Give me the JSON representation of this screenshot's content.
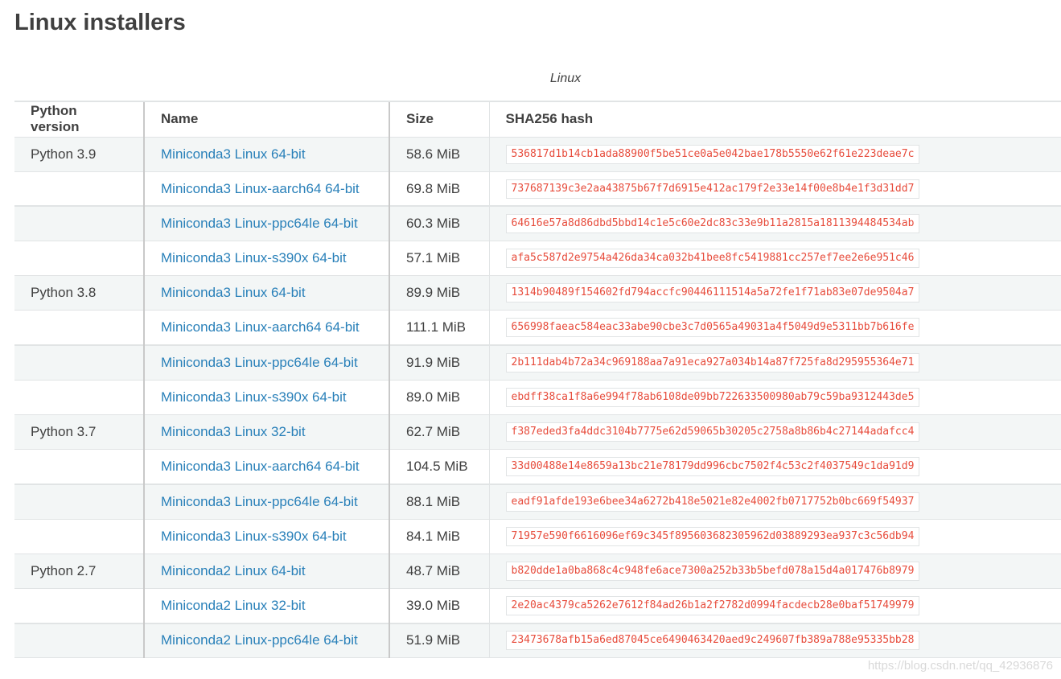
{
  "page": {
    "title": "Linux installers",
    "caption": "Linux",
    "watermark": "https://blog.csdn.net/qq_42936876"
  },
  "table": {
    "headers": [
      "Python version",
      "Name",
      "Size",
      "SHA256 hash"
    ],
    "rows": [
      {
        "version": "Python 3.9",
        "name": "Miniconda3 Linux 64-bit",
        "size": "58.6 MiB",
        "hash": "536817d1b14cb1ada88900f5be51ce0a5e042bae178b5550e62f61e223deae7c"
      },
      {
        "version": "",
        "name": "Miniconda3 Linux-aarch64 64-bit",
        "size": "69.8 MiB",
        "hash": "737687139c3e2aa43875b67f7d6915e412ac179f2e33e14f00e8b4e1f3d31dd7"
      },
      {
        "version": "",
        "name": "Miniconda3 Linux-ppc64le 64-bit",
        "size": "60.3 MiB",
        "hash": "64616e57a8d86dbd5bbd14c1e5c60e2dc83c33e9b11a2815a1811394484534ab"
      },
      {
        "version": "",
        "name": "Miniconda3 Linux-s390x 64-bit",
        "size": "57.1 MiB",
        "hash": "afa5c587d2e9754a426da34ca032b41bee8fc5419881cc257ef7ee2e6e951c46"
      },
      {
        "version": "Python 3.8",
        "name": "Miniconda3 Linux 64-bit",
        "size": "89.9 MiB",
        "hash": "1314b90489f154602fd794accfc90446111514a5a72fe1f71ab83e07de9504a7"
      },
      {
        "version": "",
        "name": "Miniconda3 Linux-aarch64 64-bit",
        "size": "111.1 MiB",
        "hash": "656998faeac584eac33abe90cbe3c7d0565a49031a4f5049d9e5311bb7b616fe"
      },
      {
        "version": "",
        "name": "Miniconda3 Linux-ppc64le 64-bit",
        "size": "91.9 MiB",
        "hash": "2b111dab4b72a34c969188aa7a91eca927a034b14a87f725fa8d295955364e71"
      },
      {
        "version": "",
        "name": "Miniconda3 Linux-s390x 64-bit",
        "size": "89.0 MiB",
        "hash": "ebdff38ca1f8a6e994f78ab6108de09bb722633500980ab79c59ba9312443de5"
      },
      {
        "version": "Python 3.7",
        "name": "Miniconda3 Linux 32-bit",
        "size": "62.7 MiB",
        "hash": "f387eded3fa4ddc3104b7775e62d59065b30205c2758a8b86b4c27144adafcc4"
      },
      {
        "version": "",
        "name": "Miniconda3 Linux-aarch64 64-bit",
        "size": "104.5 MiB",
        "hash": "33d00488e14e8659a13bc21e78179dd996cbc7502f4c53c2f4037549c1da91d9"
      },
      {
        "version": "",
        "name": "Miniconda3 Linux-ppc64le 64-bit",
        "size": "88.1 MiB",
        "hash": "eadf91afde193e6bee34a6272b418e5021e82e4002fb0717752b0bc669f54937"
      },
      {
        "version": "",
        "name": "Miniconda3 Linux-s390x 64-bit",
        "size": "84.1 MiB",
        "hash": "71957e590f6616096ef69c345f895603682305962d03889293ea937c3c56db94"
      },
      {
        "version": "Python 2.7",
        "name": "Miniconda2 Linux 64-bit",
        "size": "48.7 MiB",
        "hash": "b820dde1a0ba868c4c948fe6ace7300a252b33b5befd078a15d4a017476b8979"
      },
      {
        "version": "",
        "name": "Miniconda2 Linux 32-bit",
        "size": "39.0 MiB",
        "hash": "2e20ac4379ca5262e7612f84ad26b1a2f2782d0994facdecb28e0baf51749979"
      },
      {
        "version": "",
        "name": "Miniconda2 Linux-ppc64le 64-bit",
        "size": "51.9 MiB",
        "hash": "23473678afb15a6ed87045ce6490463420aed9c249607fb389a788e95335bb28"
      }
    ]
  },
  "colors": {
    "link": "#2980b9",
    "hash": "#e74c3c",
    "row_shade": "#f3f6f6",
    "text": "#404040"
  }
}
